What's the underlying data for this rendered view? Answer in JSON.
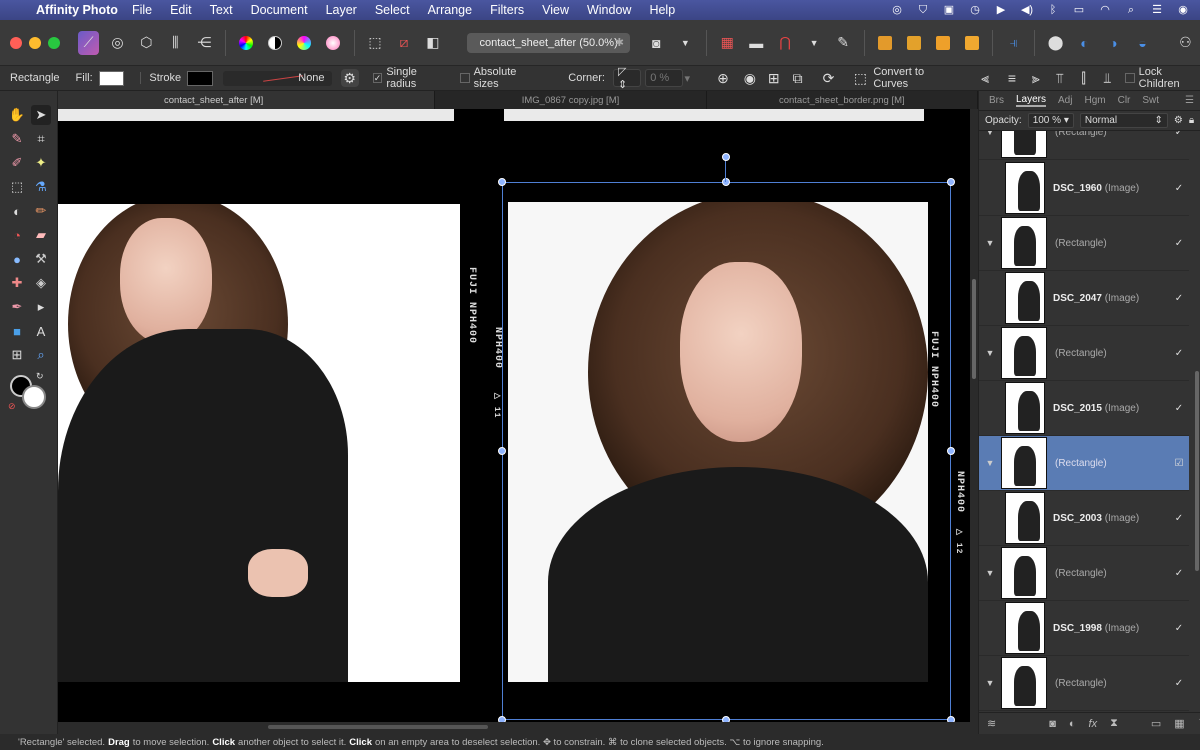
{
  "menubar": {
    "app_name": "Affinity Photo",
    "items": [
      "File",
      "Edit",
      "Text",
      "Document",
      "Layer",
      "Select",
      "Arrange",
      "Filters",
      "View",
      "Window",
      "Help"
    ]
  },
  "toolbar": {
    "document_title": "contact_sheet_after (50.0%)"
  },
  "context": {
    "tool_name": "Rectangle",
    "fill_label": "Fill:",
    "stroke_label": "Stroke",
    "stroke_width_value": "None",
    "single_radius_label": "Single radius",
    "absolute_sizes_label": "Absolute sizes",
    "corner_label": "Corner:",
    "corner_value": "0 %",
    "convert_label": "Convert to Curves",
    "lock_children_label": "Lock Children",
    "fill_color": "#ffffff",
    "stroke_color": "#000000"
  },
  "doc_tabs": [
    "contact_sheet_after [M]",
    "IMG_0867 copy.jpg [M]",
    "contact_sheet_border.png [M]"
  ],
  "canvas": {
    "rebate_left_1": "FUJI NPH400",
    "rebate_left_2": "NPH400",
    "rebate_right_1": "FUJI NPH400",
    "rebate_right_2": "NPH400",
    "frame_marks": [
      "▷ 11",
      "▷ 12"
    ]
  },
  "panel": {
    "tabs": [
      "Brs",
      "Layers",
      "Adj",
      "Hgm",
      "Clr",
      "Swt"
    ],
    "active_tab": "Layers",
    "opacity_label": "Opacity:",
    "opacity_value": "100 %",
    "blend_mode": "Normal",
    "layers": [
      {
        "name": "",
        "type": "(Rectangle)",
        "child": false,
        "selected": false
      },
      {
        "name": "DSC_1960",
        "type": "(Image)",
        "child": true,
        "selected": false
      },
      {
        "name": "",
        "type": "(Rectangle)",
        "child": false,
        "selected": false
      },
      {
        "name": "DSC_2047",
        "type": "(Image)",
        "child": true,
        "selected": false
      },
      {
        "name": "",
        "type": "(Rectangle)",
        "child": false,
        "selected": false
      },
      {
        "name": "DSC_2015",
        "type": "(Image)",
        "child": true,
        "selected": false
      },
      {
        "name": "",
        "type": "(Rectangle)",
        "child": false,
        "selected": true
      },
      {
        "name": "DSC_2003",
        "type": "(Image)",
        "child": true,
        "selected": false
      },
      {
        "name": "",
        "type": "(Rectangle)",
        "child": false,
        "selected": false
      },
      {
        "name": "DSC_1998",
        "type": "(Image)",
        "child": true,
        "selected": false
      },
      {
        "name": "",
        "type": "(Rectangle)",
        "child": false,
        "selected": false
      }
    ]
  },
  "status": {
    "p1": "'Rectangle' selected.",
    "k1": "Drag",
    "p2": "to move selection.",
    "k2": "Click",
    "p3": "another object to select it.",
    "k3": "Click",
    "p4": "on an empty area to deselect selection. ✥ to constrain. ⌘ to clone selected objects. ⌥ to ignore snapping."
  },
  "colors": {
    "accent": "#5a7cb4",
    "selection": "#4f7fd4"
  }
}
